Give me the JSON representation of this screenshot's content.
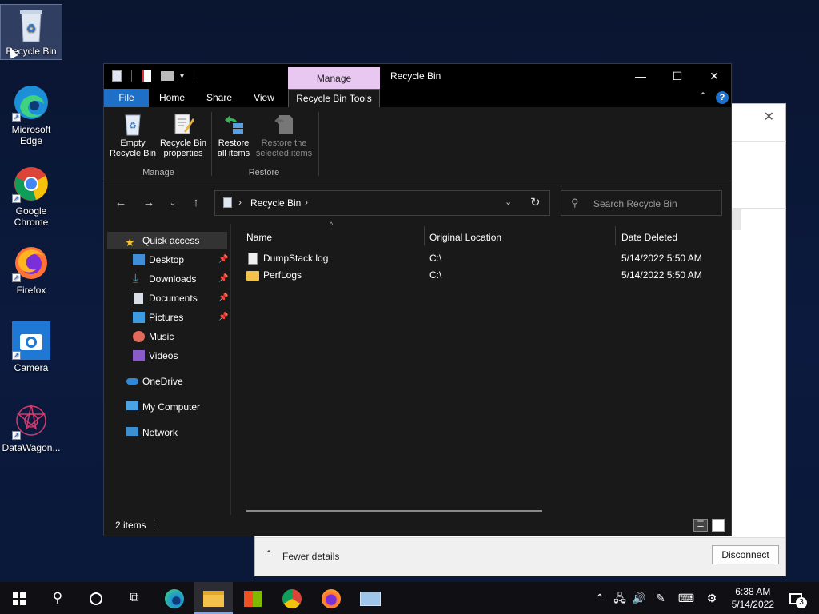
{
  "desktop": {
    "icons": [
      {
        "label": "Recycle Bin",
        "icon": "recycle-bin-icon"
      },
      {
        "label": "Microsoft Edge",
        "icon": "edge-icon"
      },
      {
        "label": "Google Chrome",
        "icon": "chrome-icon"
      },
      {
        "label": "Firefox",
        "icon": "firefox-icon"
      },
      {
        "label": "Camera",
        "icon": "camera-icon"
      },
      {
        "label": "DataWagon...",
        "icon": "datawagon-icon"
      }
    ]
  },
  "back_window": {
    "fewer_details": "Fewer details",
    "disconnect": "Disconnect"
  },
  "explorer": {
    "contextual_tab": "Manage",
    "title": "Recycle Bin",
    "tabs": [
      "File",
      "Home",
      "Share",
      "View",
      "Recycle Bin Tools"
    ],
    "ribbon": {
      "empty": "Empty\nRecycle Bin",
      "empty_l1": "Empty",
      "empty_l2": "Recycle Bin",
      "props_l1": "Recycle Bin",
      "props_l2": "properties",
      "restore_all_l1": "Restore",
      "restore_all_l2": "all items",
      "restore_sel_l1": "Restore the",
      "restore_sel_l2": "selected items",
      "group_manage": "Manage",
      "group_restore": "Restore"
    },
    "address": {
      "path": "Recycle Bin"
    },
    "search": {
      "placeholder": "Search Recycle Bin"
    },
    "sidebar": [
      {
        "label": "Quick access"
      },
      {
        "label": "Desktop"
      },
      {
        "label": "Downloads"
      },
      {
        "label": "Documents"
      },
      {
        "label": "Pictures"
      },
      {
        "label": "Music"
      },
      {
        "label": "Videos"
      },
      {
        "label": "OneDrive"
      },
      {
        "label": "My Computer"
      },
      {
        "label": "Network"
      }
    ],
    "columns": [
      "Name",
      "Original Location",
      "Date Deleted"
    ],
    "files": [
      {
        "name": "DumpStack.log",
        "location": "C:\\",
        "date": "5/14/2022 5:50 AM"
      },
      {
        "name": "PerfLogs",
        "location": "C:\\",
        "date": "5/14/2022 5:50 AM"
      }
    ],
    "status": "2 items"
  },
  "taskbar": {
    "time": "6:38 AM",
    "date": "5/14/2022",
    "notifications": "3"
  },
  "colors": {
    "accent": "#1e6fc8",
    "manage_tab": "#e8c8f0"
  }
}
